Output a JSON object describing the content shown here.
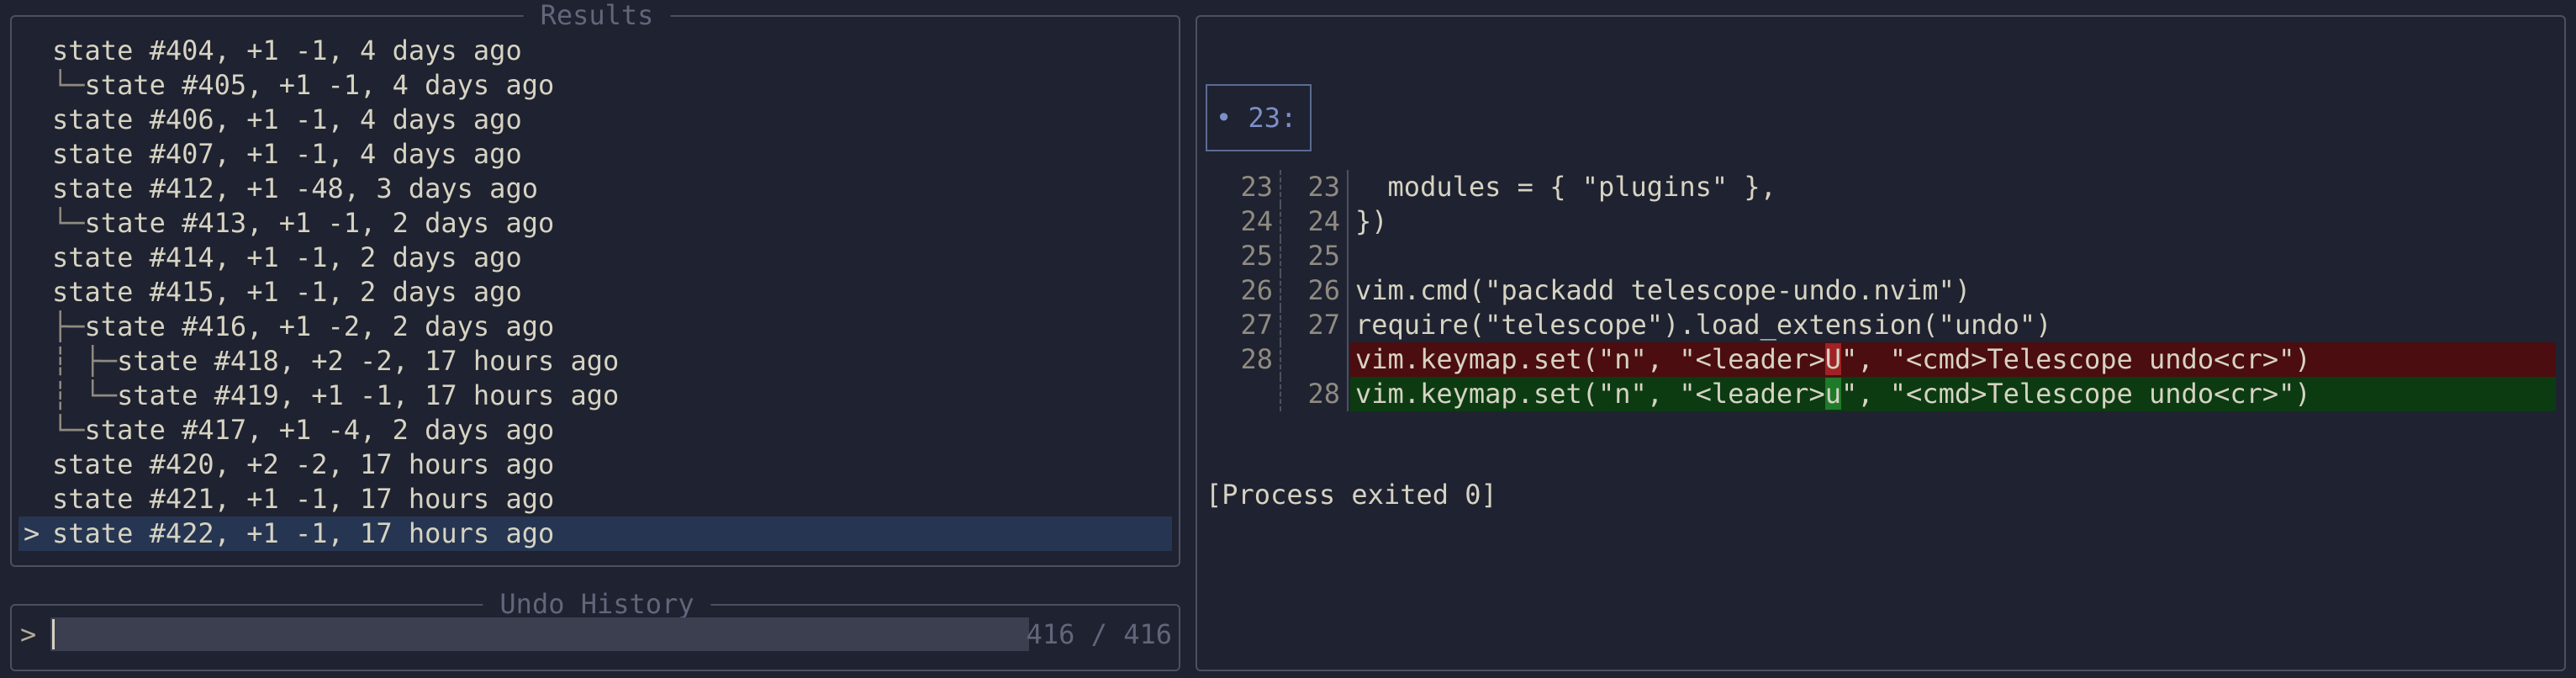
{
  "results": {
    "title": "Results",
    "rows": [
      {
        "caret": "",
        "tree": "",
        "text": "state #404, +1 -1, 4 days ago"
      },
      {
        "caret": "",
        "tree": "└─",
        "text": "state #405, +1 -1, 4 days ago"
      },
      {
        "caret": "",
        "tree": "",
        "text": "state #406, +1 -1, 4 days ago"
      },
      {
        "caret": "",
        "tree": "",
        "text": "state #407, +1 -1, 4 days ago"
      },
      {
        "caret": "",
        "tree": "",
        "text": "state #412, +1 -48, 3 days ago"
      },
      {
        "caret": "",
        "tree": "└─",
        "text": "state #413, +1 -1, 2 days ago"
      },
      {
        "caret": "",
        "tree": "",
        "text": "state #414, +1 -1, 2 days ago"
      },
      {
        "caret": "",
        "tree": "",
        "text": "state #415, +1 -1, 2 days ago"
      },
      {
        "caret": "",
        "tree": "├─",
        "text": "state #416, +1 -2, 2 days ago"
      },
      {
        "caret": "",
        "tree": "┆ ├─",
        "text": "state #418, +2 -2, 17 hours ago"
      },
      {
        "caret": "",
        "tree": "┆ └─",
        "text": "state #419, +1 -1, 17 hours ago"
      },
      {
        "caret": "",
        "tree": "└─",
        "text": "state #417, +1 -4, 2 days ago"
      },
      {
        "caret": "",
        "tree": "",
        "text": "state #420, +2 -2, 17 hours ago"
      },
      {
        "caret": "",
        "tree": "",
        "text": "state #421, +1 -1, 17 hours ago"
      },
      {
        "caret": ">",
        "tree": "",
        "text": "state #422, +1 -1, 17 hours ago"
      }
    ]
  },
  "prompt": {
    "title": "Undo History",
    "caret": ">",
    "value": "",
    "count": "416 / 416"
  },
  "preview": {
    "hunk_bullet": "•",
    "hunk_label": "23:",
    "lines": [
      {
        "old": "23",
        "new": "23",
        "type": "ctx",
        "pre": "  modules = { \"plugins\" },",
        "hl": "",
        "post": ""
      },
      {
        "old": "24",
        "new": "24",
        "type": "ctx",
        "pre": "})",
        "hl": "",
        "post": ""
      },
      {
        "old": "25",
        "new": "25",
        "type": "ctx",
        "pre": "",
        "hl": "",
        "post": ""
      },
      {
        "old": "26",
        "new": "26",
        "type": "ctx",
        "pre": "vim.cmd(\"packadd telescope-undo.nvim\")",
        "hl": "",
        "post": ""
      },
      {
        "old": "27",
        "new": "27",
        "type": "ctx",
        "pre": "require(\"telescope\").load_extension(\"undo\")",
        "hl": "",
        "post": ""
      },
      {
        "old": "28",
        "new": "",
        "type": "del",
        "pre": "vim.keymap.set(\"n\", \"<leader>",
        "hl": "U",
        "post": "\", \"<cmd>Telescope undo<cr>\")"
      },
      {
        "old": "",
        "new": "28",
        "type": "add",
        "pre": "vim.keymap.set(\"n\", \"<leader>",
        "hl": "u",
        "post": "\", \"<cmd>Telescope undo<cr>\")"
      }
    ],
    "process_text": "[Process exited 0]"
  },
  "colors": {
    "background": "#1f2230",
    "border": "#4b5062",
    "selection": "#263652",
    "deleted_bg": "#4b0d10",
    "added_bg": "#0c3b12"
  }
}
